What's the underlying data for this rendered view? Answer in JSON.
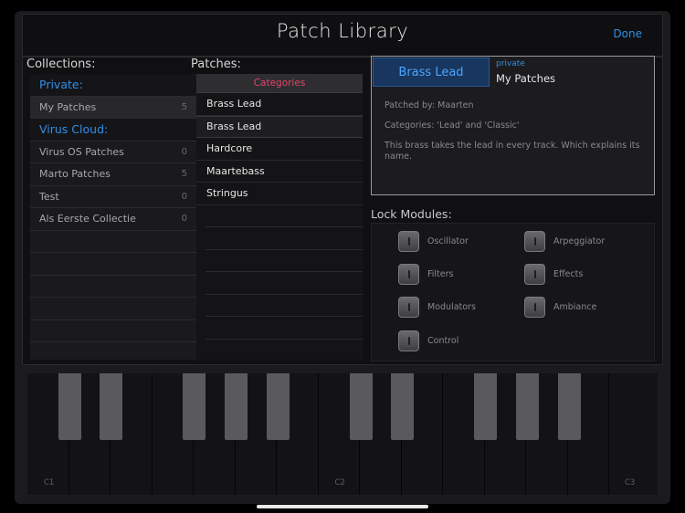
{
  "header": {
    "title": "Patch Library",
    "done_label": "Done"
  },
  "collections": {
    "heading": "Collections:",
    "private_header": "Private:",
    "private_items": [
      {
        "label": "My Patches",
        "count": "5"
      }
    ],
    "cloud_header": "Virus Cloud:",
    "cloud_items": [
      {
        "label": "Virus OS Patches",
        "count": "0"
      },
      {
        "label": "Marto Patches",
        "count": "5"
      },
      {
        "label": "Test",
        "count": "0"
      },
      {
        "label": "Als Eerste Collectie",
        "count": "0"
      }
    ]
  },
  "patches": {
    "heading": "Patches:",
    "categories_label": "Categories",
    "items": [
      "Brass Lead",
      "Brass Lead",
      "Hardcore",
      "Maartebass",
      "Stringus"
    ]
  },
  "detail": {
    "patch_name": "Brass Lead",
    "visibility_label": "private",
    "collection_name": "My Patches",
    "patched_by": "Patched by: Maarten",
    "categories": "Categories: 'Lead'  and  'Classic'",
    "description": "This brass takes the lead in every track. Which explains its name."
  },
  "lock_modules": {
    "heading": "Lock Modules:",
    "items": [
      "Oscillator",
      "Arpeggiator",
      "Filters",
      "Effects",
      "Modulators",
      "Ambiance",
      "Control"
    ]
  },
  "keyboard": {
    "note_labels": [
      "C1",
      "C2",
      "C3"
    ]
  }
}
